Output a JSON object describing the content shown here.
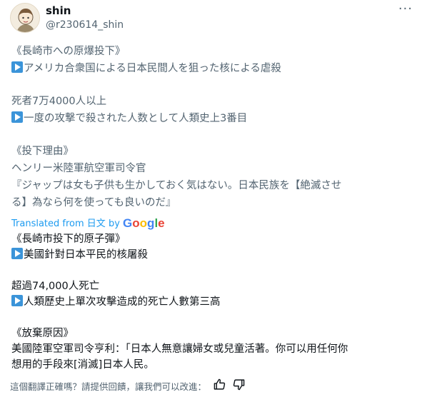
{
  "header": {
    "display_name": "shin",
    "handle": "@r230614_shin",
    "more": "···"
  },
  "original": {
    "l1": "《長崎市への原爆投下》",
    "l2": "アメリカ合衆国による日本民間人を狙った核による虐殺",
    "l3": "死者7万4000人以上",
    "l4": "一度の攻撃で殺された人数として人類史上3番目",
    "l5": "《投下理由》",
    "l6": "ヘンリー米陸軍航空軍司令官",
    "l7": "『ジャップは女も子供も生かしておく気はない。日本民族を【絶滅させ",
    "l8": "る】為なら何を使っても良いのだ』"
  },
  "translation_notice": {
    "prefix": "Translated from ",
    "language": "日文",
    "by": " by ",
    "service": "Google"
  },
  "translated": {
    "l1": "《長崎市投下的原子彈》",
    "l2": "美國針對日本平民的核屠殺",
    "l3": "超過74,000人死亡",
    "l4": "人類歷史上單次攻擊造成的死亡人數第三高",
    "l5": "《放棄原因》",
    "l6": "美國陸軍空軍司令亨利：「日本人無意讓婦女或兒童活著。你可以用任何你",
    "l7": "想用的手段來[消滅]日本人民。"
  },
  "feedback": {
    "question": "這個翻譯正確嗎？請提供回饋，讓我們可以改進："
  },
  "colors": {
    "link_blue": "#1d9bf0",
    "play_icon": "#3b94d9",
    "muted_text": "#536471"
  }
}
